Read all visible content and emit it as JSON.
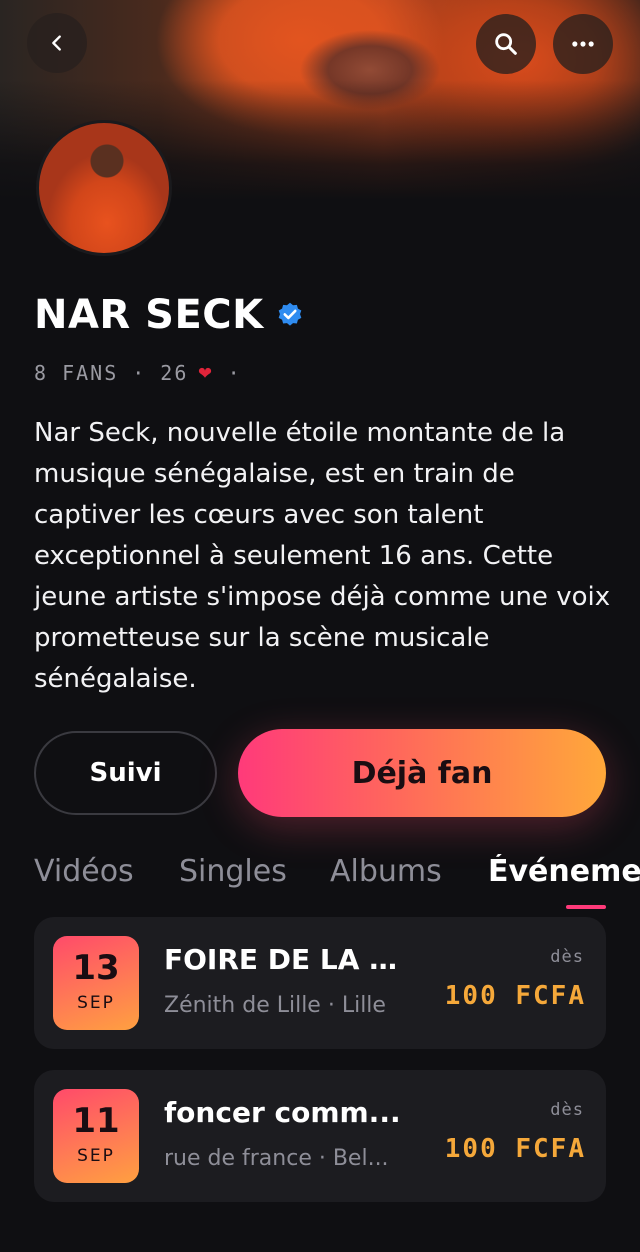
{
  "header": {
    "back_icon": "chevron-left-icon",
    "search_icon": "search-icon",
    "more_icon": "more-horizontal-icon"
  },
  "artist": {
    "name": "NAR SECK",
    "verified": true,
    "verified_color": "#2f8cf0",
    "fans": "8 FANS",
    "likes": "26",
    "separator": "·",
    "heart": "❤",
    "bio": "Nar Seck, nouvelle étoile montante de la musique sénégalaise, est en train de captiver les cœurs avec son talent exceptionnel à seulement 16 ans. Cette jeune artiste s'impose déjà comme une voix prometteuse sur la scène musicale sénégalaise."
  },
  "actions": {
    "follow_label": "Suivi",
    "fan_label": "Déjà fan"
  },
  "tabs": {
    "items": [
      "Vidéos",
      "Singles",
      "Albums",
      "Événements"
    ],
    "active": "Événements",
    "accent": "#ff3a7a"
  },
  "events": [
    {
      "day": "13",
      "month": "SEP",
      "title": "FOIRE DE LA M...",
      "venue": "Zénith de Lille · Lille",
      "from_label": "dès",
      "price": "100 FCFA"
    },
    {
      "day": "11",
      "month": "SEP",
      "title": "foncer comm...",
      "venue": "rue de france · Bel...",
      "from_label": "dès",
      "price": "100 FCFA"
    }
  ],
  "colors": {
    "background": "#0f0f12",
    "card": "#1c1c20",
    "price": "#f5a83a",
    "gradient_start": "#ff3a7a",
    "gradient_end": "#ffa83a"
  }
}
